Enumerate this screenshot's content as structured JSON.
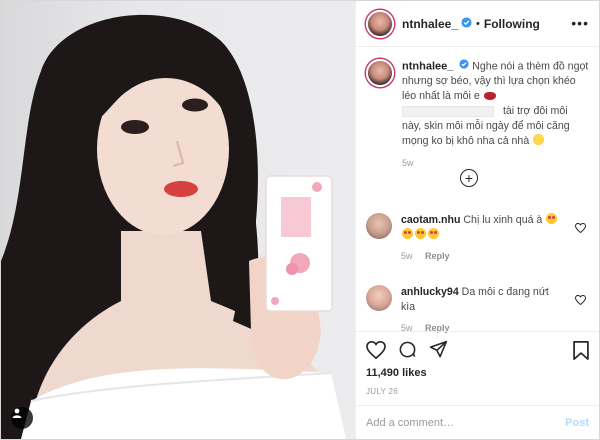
{
  "post": {
    "username": "ntnhalee_",
    "follow_label": "Following",
    "more_label": "•••",
    "caption": {
      "username": "ntnhalee_",
      "line1": "Nghe nói a thèm đồ ngọt nhưng sợ béo, vậy thì lựa chọn khéo léo nhất là môi e",
      "line2": "tài trợ đôi môi này, skin môi mỗi ngày để môi căng mọng ko bị khô nha cả nhà",
      "time": "5w"
    },
    "comments": [
      {
        "username": "caotam.nhu",
        "text": "Chị lu xinh quá à",
        "time": "5w",
        "reply_label": "Reply"
      },
      {
        "username": "anhlucky94",
        "text": "Da môi c đang nứt kìa",
        "time": "5w",
        "reply_label": "Reply"
      }
    ],
    "likes": "11,490 likes",
    "date": "JULY 26",
    "add_comment_placeholder": "Add a comment…",
    "post_label": "Post"
  },
  "colors": {
    "accent_blue": "#0095f6",
    "verified_blue": "#3897f0",
    "post_disabled": "#b3dbff",
    "story_ring": "#c83a6b"
  }
}
